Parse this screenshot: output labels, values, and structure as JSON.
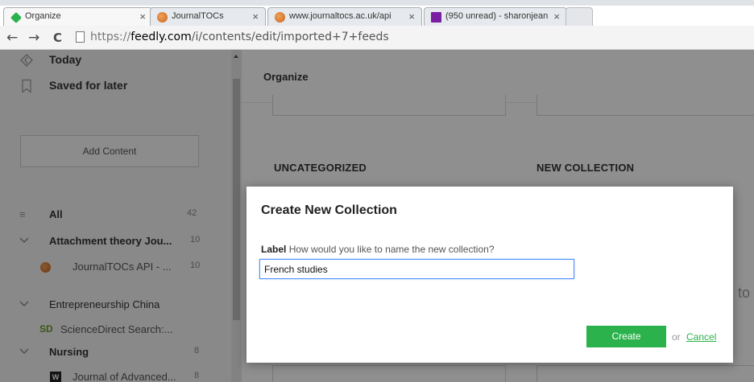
{
  "browser": {
    "tabs": [
      {
        "title": "Organize",
        "favicon": "feedly-icon",
        "active": true
      },
      {
        "title": "JournalTOCs",
        "favicon": "journaltocs-icon",
        "active": false
      },
      {
        "title": "www.journaltocs.ac.uk/api",
        "favicon": "journaltocs-icon",
        "active": false
      },
      {
        "title": "(950 unread) - sharonjean",
        "favicon": "mail-icon",
        "active": false
      }
    ],
    "close_glyph": "×",
    "address": {
      "scheme": "https://",
      "host": "feedly.com",
      "path": "/i/contents/edit/imported+7+feeds"
    },
    "nav": {
      "back": "←",
      "forward": "→",
      "reload": "C"
    }
  },
  "sidebar": {
    "today": "Today",
    "saved": "Saved for later",
    "add_content": "Add Content",
    "all": {
      "label": "All",
      "count": "42"
    },
    "feeds": [
      {
        "label": "Attachment theory Jou...",
        "count": "10",
        "bold": true,
        "expand": "chevron-down-icon"
      },
      {
        "label": "JournalTOCs API - ...",
        "count": "10",
        "bold": false,
        "icon_text": ""
      },
      {
        "label": "Entrepreneurship China",
        "count": "",
        "bold": false,
        "expand": "chevron-down-icon"
      },
      {
        "label": "ScienceDirect Search:...",
        "count": "",
        "bold": false,
        "icon_text": "SD"
      },
      {
        "label": "Nursing",
        "count": "8",
        "bold": true,
        "expand": "chevron-down-icon"
      },
      {
        "label": "Journal of Advanced...",
        "count": "8",
        "bold": false,
        "icon_text": "W"
      }
    ]
  },
  "main": {
    "title": "Organize",
    "uncategorized": "UNCATEGORIZED",
    "new_collection": "NEW COLLECTION",
    "ghost_text": "to"
  },
  "modal": {
    "title": "Create New Collection",
    "label_bold": "Label",
    "label_hint": "How would you like to name the new collection?",
    "input_value": "French studies",
    "create": "Create",
    "or": "or",
    "cancel": "Cancel"
  },
  "colors": {
    "accent": "#2bb24c",
    "overlay": "rgba(0,0,0,0.44)",
    "focus": "#4d90fe"
  }
}
